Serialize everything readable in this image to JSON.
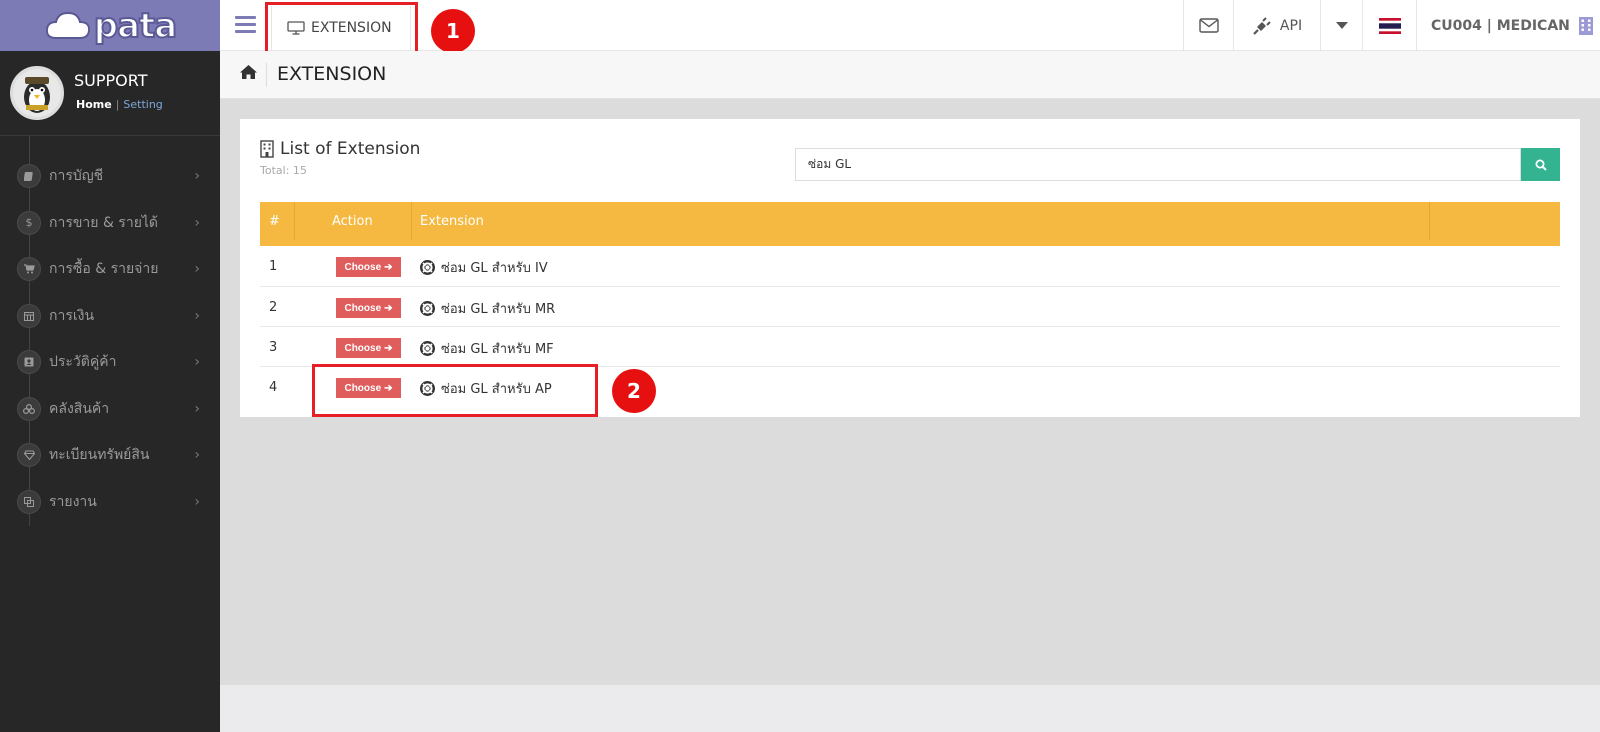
{
  "app": {
    "logo_text": "pata"
  },
  "profile": {
    "name": "SUPPORT",
    "home_link": "Home",
    "separator": "|",
    "setting_link": "Setting"
  },
  "sidebar": {
    "items": [
      {
        "label": "การบัญชี",
        "icon": "book-icon"
      },
      {
        "label": "การขาย & รายได้",
        "icon": "dollar-icon"
      },
      {
        "label": "การซื้อ & รายจ่าย",
        "icon": "cart-icon"
      },
      {
        "label": "การเงิน",
        "icon": "calendar-icon"
      },
      {
        "label": "ประวัติคู่ค้า",
        "icon": "contact-icon"
      },
      {
        "label": "คลังสินค้า",
        "icon": "boxes-icon"
      },
      {
        "label": "ทะเบียนทรัพย์สิน",
        "icon": "diamond-icon"
      },
      {
        "label": "รายงาน",
        "icon": "copy-icon"
      }
    ],
    "arrow": "›"
  },
  "topbar": {
    "active_tab": "EXTENSION",
    "api_label": "API",
    "user_label": "CU004 | MEDICAN"
  },
  "callouts": {
    "one": "1",
    "two": "2"
  },
  "breadcrumb": {
    "title": "EXTENSION"
  },
  "panel": {
    "title": "List of Extension",
    "total": "Total: 15",
    "search_value": "ซ่อม GL"
  },
  "table": {
    "headers": {
      "num": "#",
      "action": "Action",
      "extension": "Extension"
    },
    "choose_label": "Choose",
    "rows": [
      {
        "num": "1",
        "name": "ซ่อม GL สำหรับ IV"
      },
      {
        "num": "2",
        "name": "ซ่อม GL สำหรับ MR"
      },
      {
        "num": "3",
        "name": "ซ่อม GL สำหรับ MF"
      },
      {
        "num": "4",
        "name": "ซ่อม GL สำหรับ AP"
      }
    ]
  },
  "colors": {
    "sidebar_bg": "#272727",
    "logo_bg": "#7d7bb6",
    "table_header": "#f5b942",
    "choose_button": "#e05d5d",
    "search_button": "#33b38f",
    "callout_red": "#e61010"
  }
}
